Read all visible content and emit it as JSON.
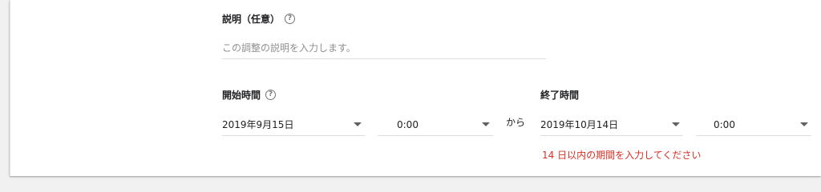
{
  "description": {
    "label": "説明（任意）",
    "placeholder": "この調整の説明を入力します。"
  },
  "start": {
    "label": "開始時間",
    "date": "2019年9月15日",
    "time": "0:00"
  },
  "connector": "から",
  "end": {
    "label": "終了時間",
    "date": "2019年10月14日",
    "time": "0:00",
    "error": "14 日以内の期間を入力してください"
  },
  "icons": {
    "help": "help-icon",
    "dropdown": "dropdown-caret-icon"
  },
  "colors": {
    "error": "#d93025",
    "underline": "#dadce0"
  }
}
